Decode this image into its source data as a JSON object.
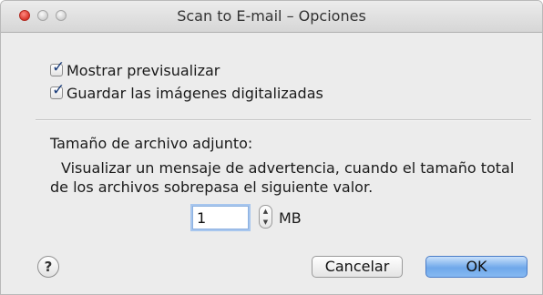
{
  "window": {
    "title": "Scan to E-mail – Opciones"
  },
  "options": {
    "show_preview": {
      "label": "Mostrar previsualizar",
      "checked": true
    },
    "save_images": {
      "label": "Guardar las imágenes digitalizadas",
      "checked": true
    }
  },
  "attachment": {
    "heading": "Tamaño de archivo adjunto:",
    "description_line1": "Visualizar un mensaje de advertencia, cuando el tamaño total",
    "description_line2": "de los archivos sobrepasa el siguiente valor.",
    "size_value": "1",
    "unit": "MB"
  },
  "buttons": {
    "help": "?",
    "cancel": "Cancelar",
    "ok": "OK"
  },
  "icons": {
    "checkmark": "✓",
    "stepper_up": "▲",
    "stepper_down": "▼"
  },
  "colors": {
    "accent": "#6fa8ea",
    "close_button": "#d9372c"
  }
}
